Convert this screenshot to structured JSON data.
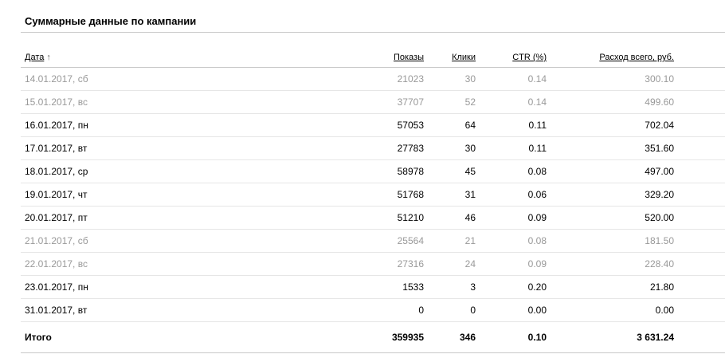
{
  "title": "Суммарные данные по кампании",
  "headers": {
    "date": "Дата",
    "date_sort_arrow": "↑",
    "shows": "Показы",
    "clicks": "Клики",
    "ctr": "CTR (%)",
    "spend": "Расход всего, руб."
  },
  "rows": [
    {
      "date": "14.01.2017, сб",
      "shows": "21023",
      "clicks": "30",
      "ctr": "0.14",
      "spend": "300.10",
      "weekend": true
    },
    {
      "date": "15.01.2017, вс",
      "shows": "37707",
      "clicks": "52",
      "ctr": "0.14",
      "spend": "499.60",
      "weekend": true
    },
    {
      "date": "16.01.2017, пн",
      "shows": "57053",
      "clicks": "64",
      "ctr": "0.11",
      "spend": "702.04",
      "weekend": false
    },
    {
      "date": "17.01.2017, вт",
      "shows": "27783",
      "clicks": "30",
      "ctr": "0.11",
      "spend": "351.60",
      "weekend": false
    },
    {
      "date": "18.01.2017, ср",
      "shows": "58978",
      "clicks": "45",
      "ctr": "0.08",
      "spend": "497.00",
      "weekend": false
    },
    {
      "date": "19.01.2017, чт",
      "shows": "51768",
      "clicks": "31",
      "ctr": "0.06",
      "spend": "329.20",
      "weekend": false
    },
    {
      "date": "20.01.2017, пт",
      "shows": "51210",
      "clicks": "46",
      "ctr": "0.09",
      "spend": "520.00",
      "weekend": false
    },
    {
      "date": "21.01.2017, сб",
      "shows": "25564",
      "clicks": "21",
      "ctr": "0.08",
      "spend": "181.50",
      "weekend": true
    },
    {
      "date": "22.01.2017, вс",
      "shows": "27316",
      "clicks": "24",
      "ctr": "0.09",
      "spend": "228.40",
      "weekend": true
    },
    {
      "date": "23.01.2017, пн",
      "shows": "1533",
      "clicks": "3",
      "ctr": "0.20",
      "spend": "21.80",
      "weekend": false
    },
    {
      "date": "31.01.2017, вт",
      "shows": "0",
      "clicks": "0",
      "ctr": "0.00",
      "spend": "0.00",
      "weekend": false
    }
  ],
  "total": {
    "label": "Итого",
    "shows": "359935",
    "clicks": "346",
    "ctr": "0.10",
    "spend": "3 631.24"
  },
  "colors": {
    "weekend_text": "#999999",
    "rule": "#c8c8c8"
  }
}
